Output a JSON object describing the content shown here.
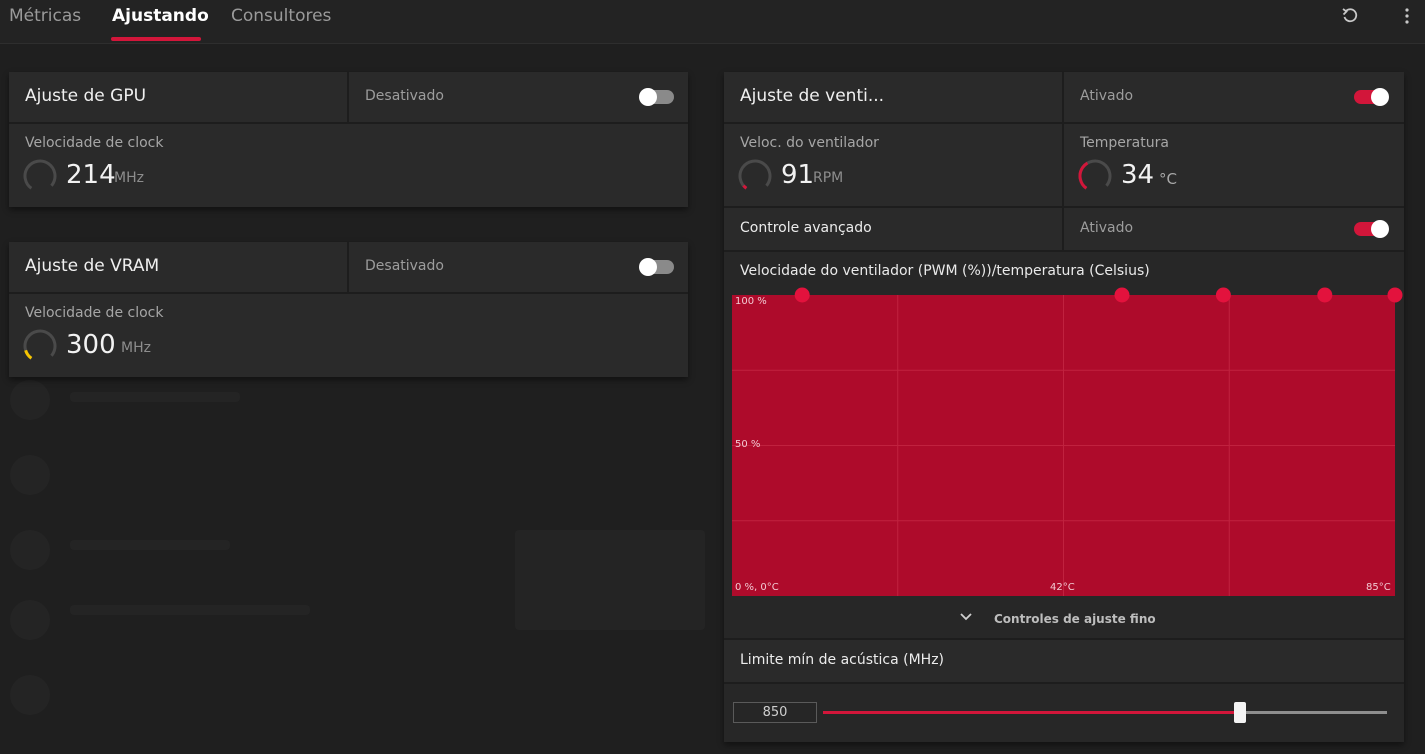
{
  "tabs": [
    {
      "label": "Métricas",
      "active": false
    },
    {
      "label": "Ajustando",
      "active": true
    },
    {
      "label": "Consultores",
      "active": false
    }
  ],
  "toolbar": {
    "reset_icon": "undo-icon",
    "menu_icon": "more-vertical-icon"
  },
  "colors": {
    "accent": "#d2163a",
    "chart_fill": "#ae0b2b",
    "background": "#1f1f1f",
    "card": "#2a2a2a",
    "vram_gauge": "#f5c400"
  },
  "gpu_tuning": {
    "title": "Ajuste de GPU",
    "status": "Desativado",
    "enabled": false,
    "clock_label": "Velocidade de clock",
    "clock_value": "214",
    "clock_unit": "MHz"
  },
  "vram_tuning": {
    "title": "Ajuste de VRAM",
    "status": "Desativado",
    "enabled": false,
    "clock_label": "Velocidade de clock",
    "clock_value": "300",
    "clock_unit": "MHz"
  },
  "fan_tuning": {
    "title": "Ajuste de venti...",
    "status": "Ativado",
    "enabled": true,
    "fan_speed_label": "Veloc. do ventilador",
    "fan_speed_value": "91",
    "fan_speed_unit": "RPM",
    "temperature_label": "Temperatura",
    "temperature_value": "34",
    "temperature_unit": "°C",
    "advanced_label": "Controle avançado",
    "advanced_status": "Ativado",
    "advanced_enabled": true,
    "fine_tune_label": "Controles de ajuste fino",
    "acoustic_label": "Limite mín de acústica (MHz)",
    "acoustic_value": "850",
    "acoustic_level": 0.74
  },
  "chart_data": {
    "type": "area",
    "title": "Velocidade do ventilador (PWM (%))/temperatura (Celsius)",
    "y_ticks": [
      "100 %",
      "50 %",
      "0 %, 0°C"
    ],
    "x_ticks": [
      "42°C",
      "85°C"
    ],
    "xlim": [
      0,
      85
    ],
    "ylim": [
      0,
      100
    ],
    "grid": true,
    "points": [
      {
        "x": 9,
        "y": 100
      },
      {
        "x": 50,
        "y": 100
      },
      {
        "x": 63,
        "y": 100
      },
      {
        "x": 76,
        "y": 100
      },
      {
        "x": 85,
        "y": 100
      }
    ]
  }
}
